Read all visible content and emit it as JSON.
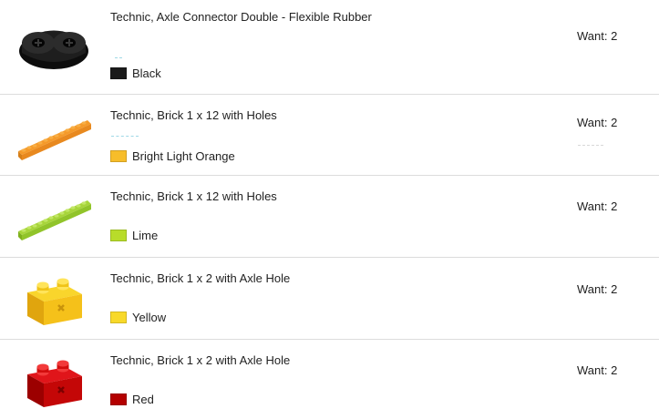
{
  "items": [
    {
      "name": "Technic, Axle Connector Double - Flexible Rubber",
      "color_name": "Black",
      "color_hex": "#1b1b1b",
      "want": "Want: 2",
      "icon": "axle-connector-double-part-icon"
    },
    {
      "name": "Technic, Brick 1 x 12 with Holes",
      "color_name": "Bright Light Orange",
      "color_hex": "#f7bd2a",
      "want": "Want: 2",
      "icon": "technic-brick-1x12-part-icon"
    },
    {
      "name": "Technic, Brick 1 x 12 with Holes",
      "color_name": "Lime",
      "color_hex": "#b8dc2a",
      "want": "Want: 2",
      "icon": "technic-brick-1x12-part-icon"
    },
    {
      "name": "Technic, Brick 1 x 2 with Axle Hole",
      "color_name": "Yellow",
      "color_hex": "#f8d92a",
      "want": "Want: 2",
      "icon": "technic-brick-1x2-axle-part-icon"
    },
    {
      "name": "Technic, Brick 1 x 2 with Axle Hole",
      "color_name": "Red",
      "color_hex": "#b40000",
      "want": "Want: 2",
      "icon": "technic-brick-1x2-axle-part-icon"
    }
  ]
}
